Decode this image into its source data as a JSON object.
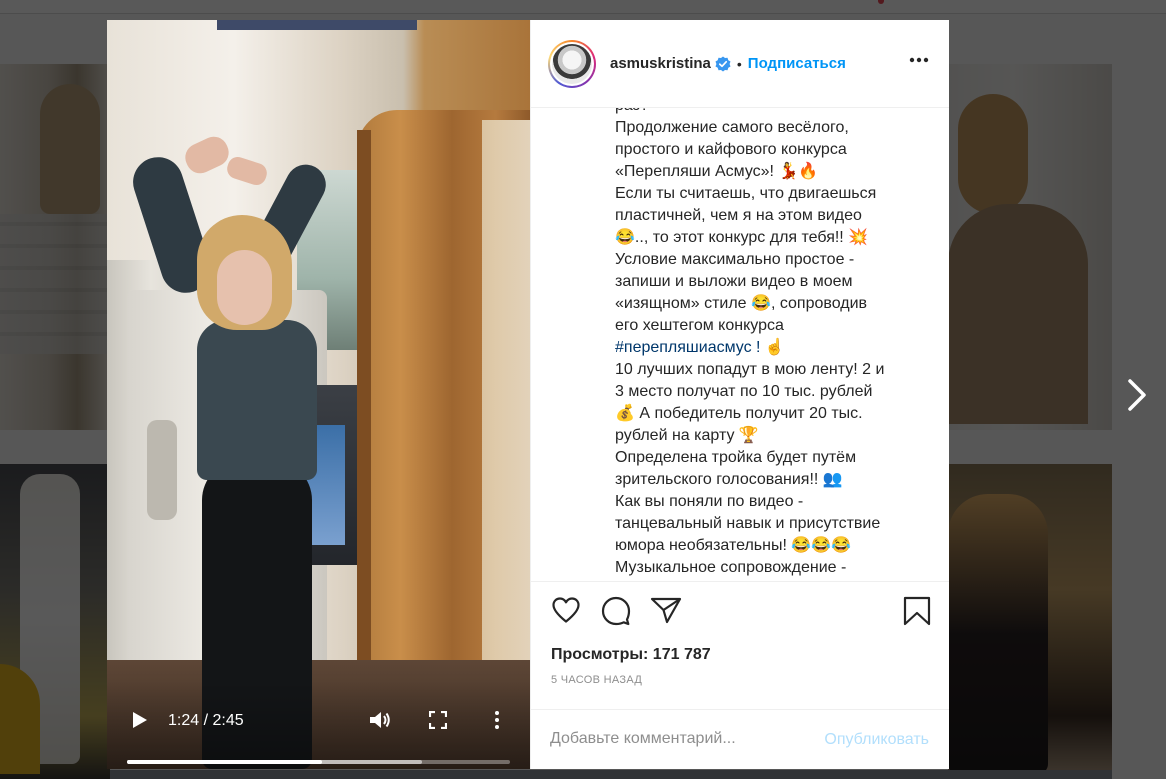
{
  "post": {
    "username": "asmuskristina",
    "follow_label": "Подписаться",
    "separator": "•",
    "views_label": "Просмотры:",
    "views_count": "171 787",
    "time_ago": "5 ЧАСОВ НАЗАД"
  },
  "video": {
    "time": "1:24 / 2:45",
    "played_fraction": 0.51,
    "buffered_fraction": 0.77
  },
  "caption": {
    "lines": [
      "раз?",
      "Продолжение самого весёлого,",
      "простого и кайфового конкурса",
      "«Перепляши Асмус»! 💃🔥",
      "Если ты считаешь, что двигаешься",
      "пластичней, чем я на этом видео",
      "😂.., то этот конкурс для тебя!! 💥",
      "Условие максимально простое -",
      "запиши и выложи видео в моем",
      "«изящном» стиле 😂, сопроводив",
      "его хештегом конкурса",
      "#перепляшиасмус ! ☝️",
      "10 лучших попадут в мою ленту! 2 и",
      "3 место получат по 10 тыс. рублей",
      "💰 А победитель получит 20 тыс.",
      "рублей на карту 🏆",
      "Определена тройка будет путём",
      "зрительского голосования!! 👥",
      "Как вы поняли по видео -",
      "танцевальный навык и присутствие",
      "юмора необязательны! 😂😂😂",
      "Музыкальное сопровождение -"
    ],
    "hashtag_line_index": 11
  },
  "comment": {
    "placeholder": "Добавьте комментарий...",
    "publish_label": "Опубликовать"
  },
  "colors": {
    "link_blue": "#0095f6",
    "publish_disabled": "#b2dffc",
    "text": "#262626",
    "muted": "#8e8e8e"
  },
  "icons": [
    "verified-badge-icon",
    "more-horizontal-icon",
    "heart-icon",
    "comment-icon",
    "share-icon",
    "bookmark-icon",
    "play-icon",
    "volume-icon",
    "fullscreen-icon",
    "more-vertical-icon",
    "chevron-right-icon"
  ]
}
